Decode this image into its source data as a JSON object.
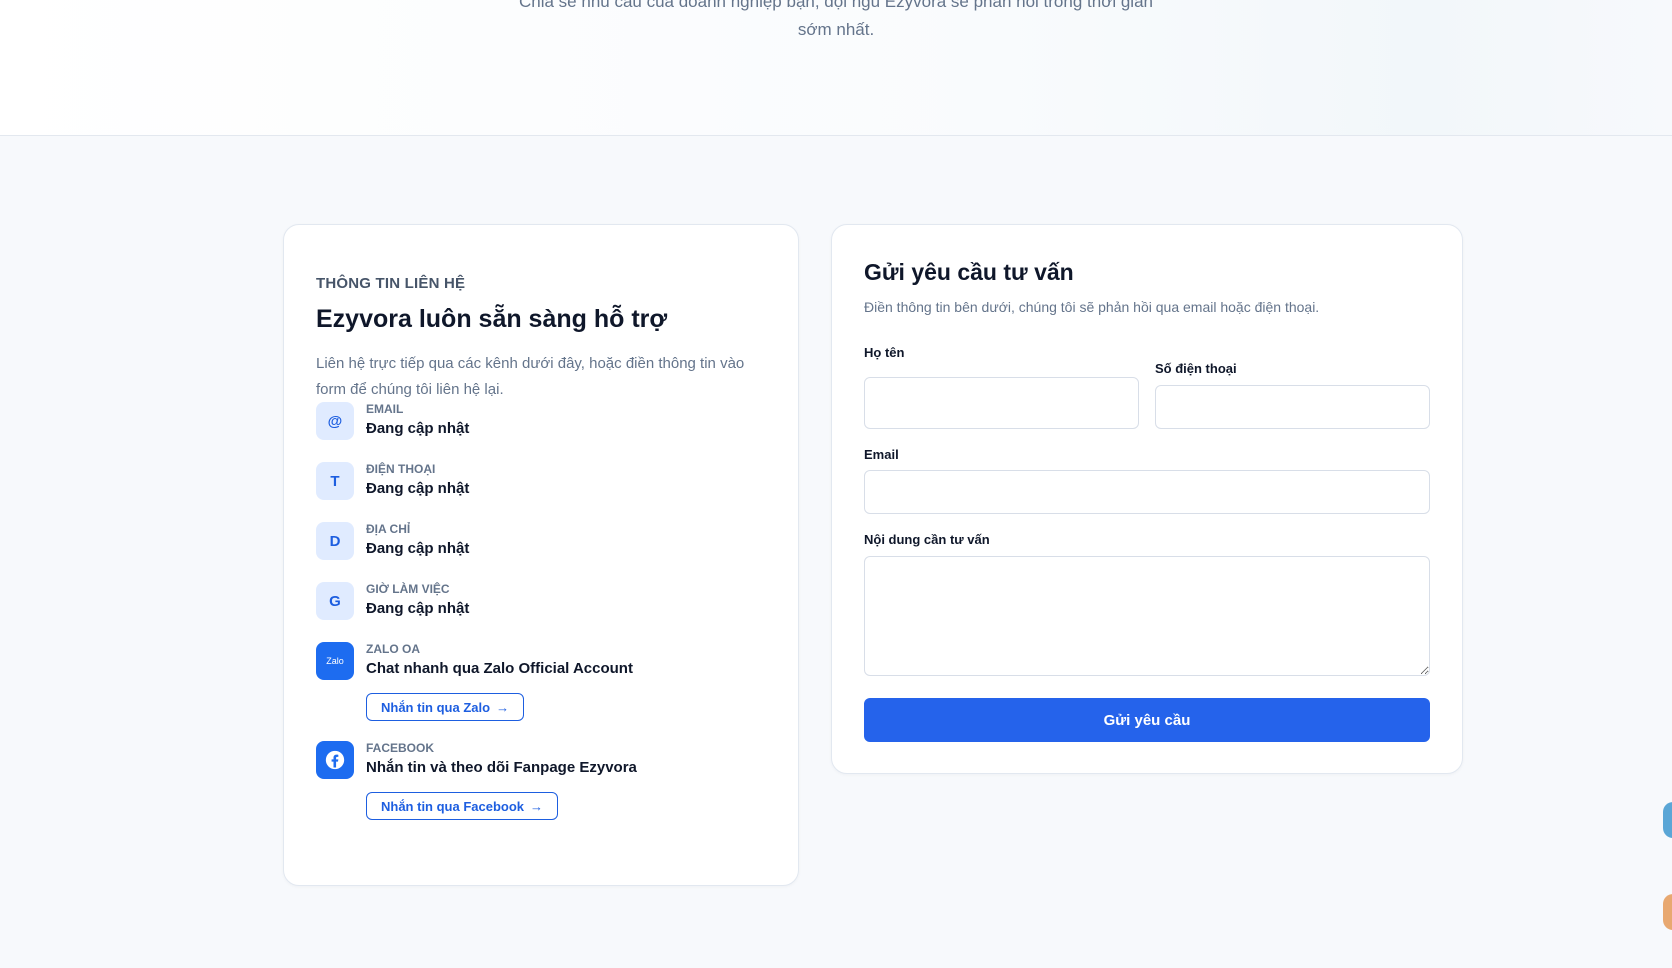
{
  "hero": {
    "line1": "Chia sẻ nhu cầu của doanh nghiệp bạn, đội ngũ Ezyvora sẽ phản hồi trong thời gian",
    "line2": "sớm nhất."
  },
  "contact": {
    "eyebrow": "THÔNG TIN LIÊN HỆ",
    "title": "Ezyvora luôn sẵn sàng hỗ trợ",
    "description": "Liên hệ trực tiếp qua các kênh dưới đây, hoặc điền thông tin vào form để chúng tôi liên hệ lại.",
    "items": [
      {
        "icon": "@",
        "label": "EMAIL",
        "value": "Đang cập nhật"
      },
      {
        "icon": "T",
        "label": "ĐIỆN THOẠI",
        "value": "Đang cập nhật"
      },
      {
        "icon": "D",
        "label": "ĐỊA CHỈ",
        "value": "Đang cập nhật"
      },
      {
        "icon": "G",
        "label": "GIỜ LÀM VIỆC",
        "value": "Đang cập nhật"
      },
      {
        "icon": "Zalo",
        "label": "ZALO OA",
        "value": "Chat nhanh qua Zalo Official Account",
        "link": "Nhắn tin qua Zalo"
      },
      {
        "icon": "facebook-logo",
        "label": "FACEBOOK",
        "value": "Nhắn tin và theo dõi Fanpage Ezyvora",
        "link": "Nhắn tin qua Facebook"
      }
    ]
  },
  "form": {
    "title": "Gửi yêu cầu tư vấn",
    "description": "Điền thông tin bên dưới, chúng tôi sẽ phản hồi qua email hoặc điện thoại.",
    "name_label": "Họ tên",
    "name_value": "",
    "phone_label": "Số điện thoại",
    "phone_value": "",
    "email_label": "Email",
    "email_value": "",
    "message_label": "Nội dung cần tư vấn",
    "message_value": "",
    "submit_label": "Gửi yêu cầu"
  },
  "colors": {
    "primary": "#2563eb",
    "icon_bg": "#e0ebff",
    "page_bg": "#f7f9fc"
  }
}
